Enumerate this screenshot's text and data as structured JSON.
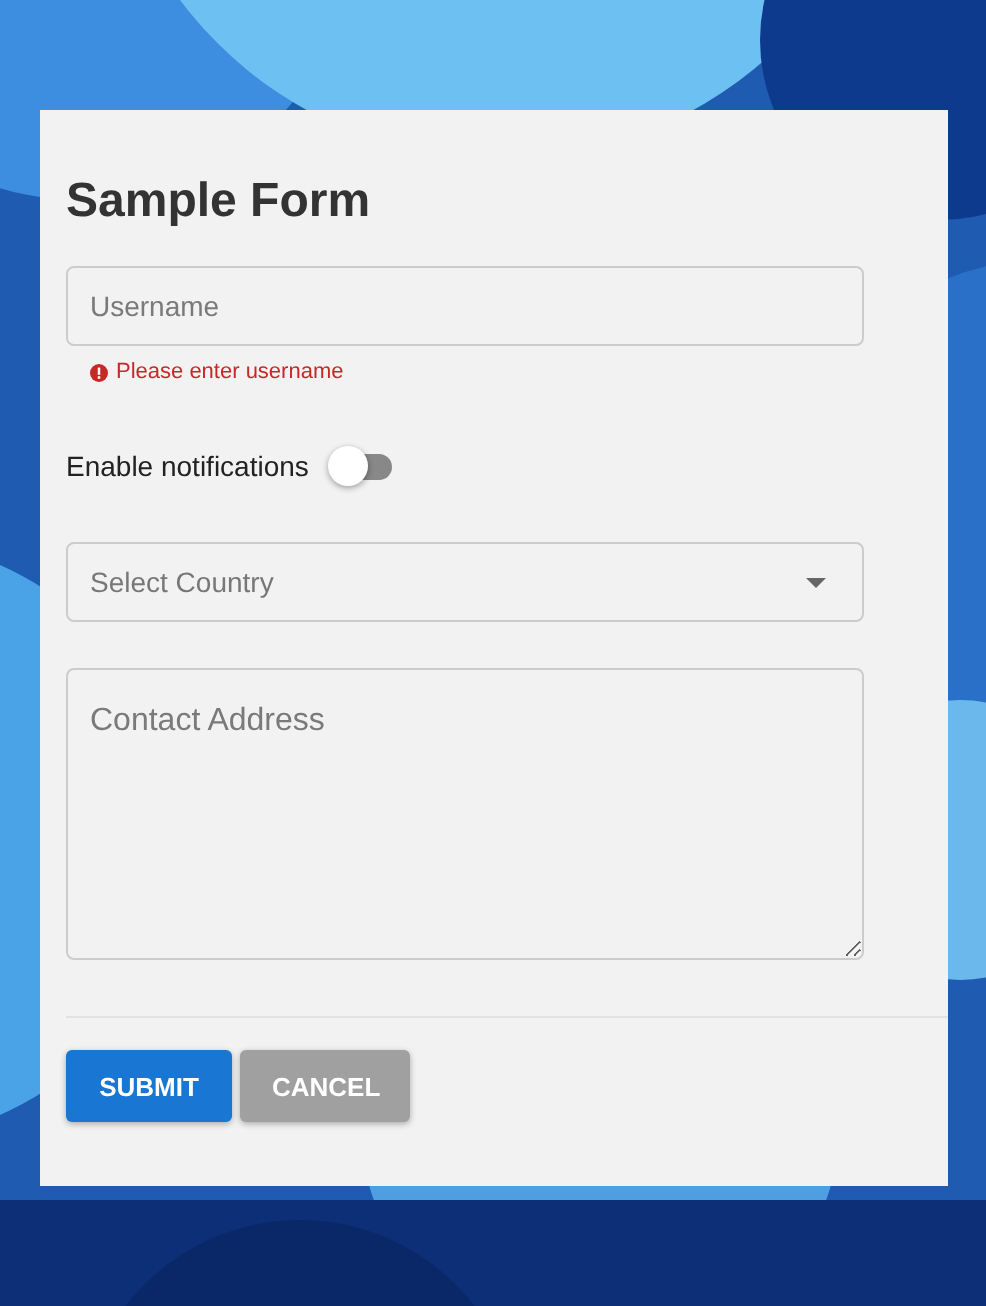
{
  "form": {
    "title": "Sample Form",
    "username": {
      "placeholder": "Username",
      "error": "Please enter username"
    },
    "notifications": {
      "label": "Enable notifications",
      "on": false
    },
    "country": {
      "placeholder": "Select Country"
    },
    "address": {
      "placeholder": "Contact Address"
    },
    "buttons": [
      {
        "label": "SUBMIT",
        "kind": "primary"
      },
      {
        "label": "CANCEL",
        "kind": "secondary"
      }
    ]
  }
}
